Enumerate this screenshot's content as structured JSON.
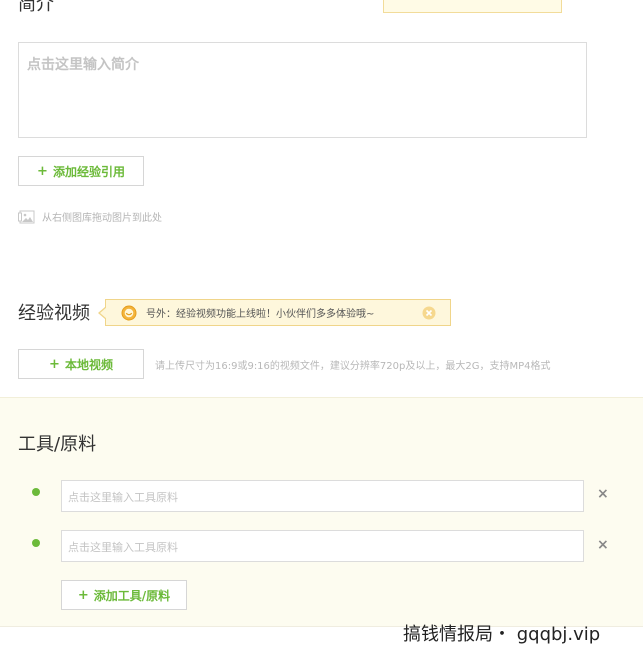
{
  "intro": {
    "title": "简介",
    "placeholder": "点击这里输入简介",
    "add_reference_label": "添加经验引用",
    "drag_hint": "从右侧图库拖动图片到此处"
  },
  "video": {
    "title": "经验视频",
    "notice_text": "号外：经验视频功能上线啦！小伙伴们多多体验哦~",
    "upload_label": "本地视频",
    "upload_hint": "请上传尺寸为16:9或9:16的视频文件，建议分辨率720p及以上，最大2G，支持MP4格式"
  },
  "tools": {
    "title": "工具/原料",
    "items": [
      {
        "placeholder": "点击这里输入工具原料"
      },
      {
        "placeholder": "点击这里输入工具原料"
      }
    ],
    "add_label": "添加工具/原料"
  },
  "watermark": "搞钱情报局・ gqqbj.vip",
  "colors": {
    "accent_green": "#6cba3a",
    "notice_bg": "#fef7dc",
    "panel_bg": "#fdfcf0"
  },
  "icons": {
    "plus": "+",
    "close": "×"
  }
}
